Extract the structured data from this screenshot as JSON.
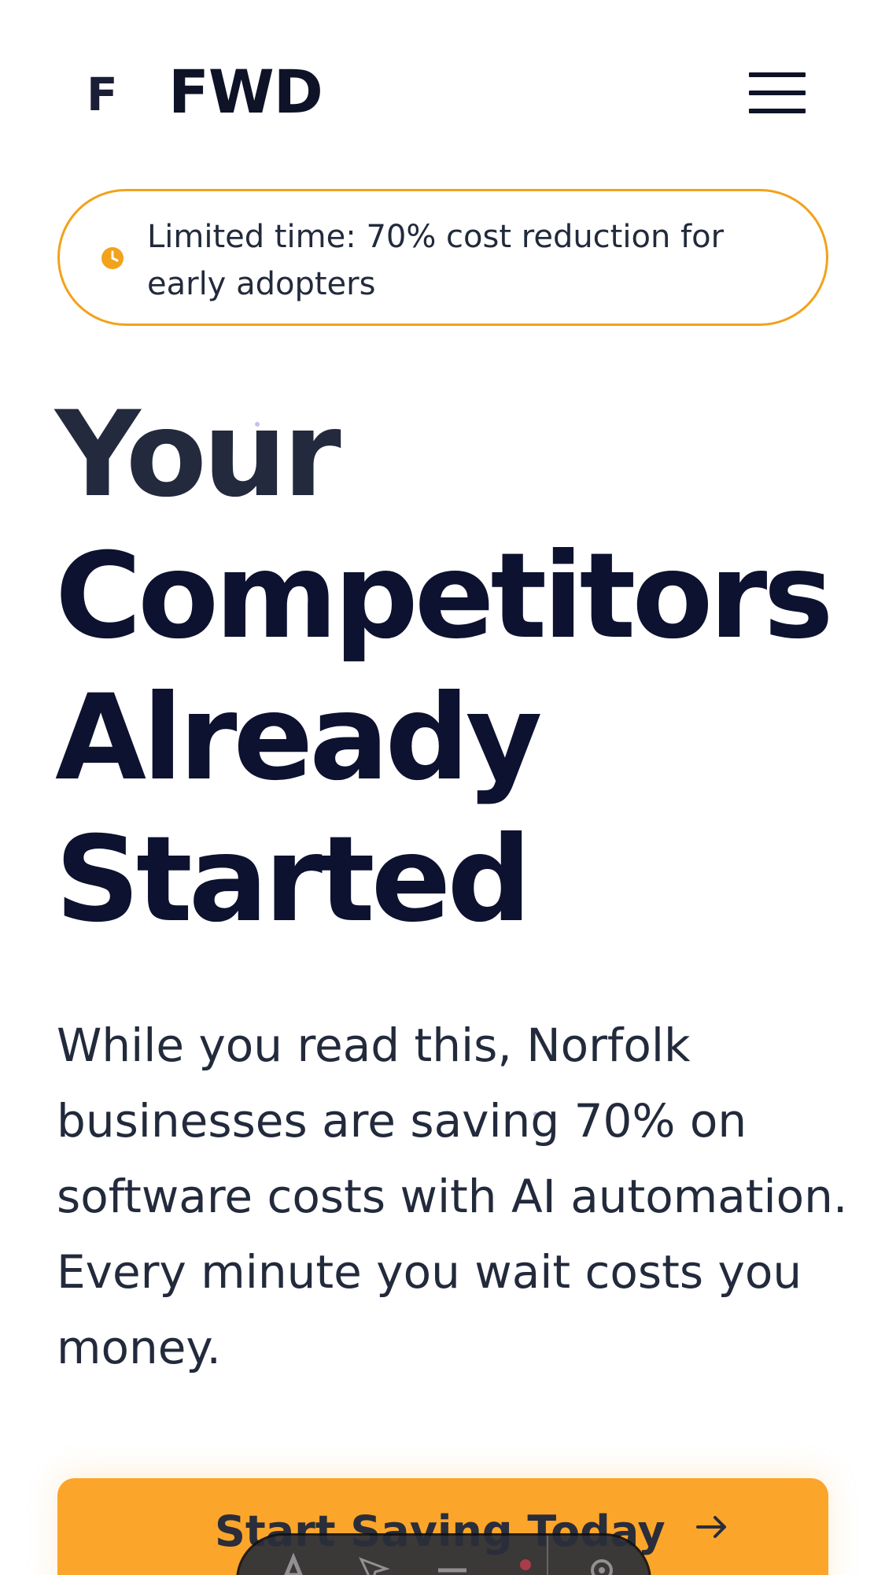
{
  "header": {
    "logo_mark": "F",
    "logo_text": "FWD",
    "menu_icon": "hamburger-menu-icon"
  },
  "promo": {
    "icon": "clock-icon",
    "text": "Limited time: 70% cost reduction for early adopters",
    "accent_color": "#f2a21b"
  },
  "hero": {
    "headline_lines": [
      "Your",
      "Competitors",
      "Already",
      "Started"
    ],
    "lead": "While you read this, Norfolk businesses are saving 70% on software costs with AI automation. Every minute you wait costs you money."
  },
  "cta": {
    "label": "Start Saving Today",
    "icon": "arrow-right-icon",
    "color": "#fba52a"
  },
  "toolbar": {
    "icons": [
      "text-icon",
      "pointer-icon",
      "minus-icon",
      "settings-icon"
    ]
  }
}
